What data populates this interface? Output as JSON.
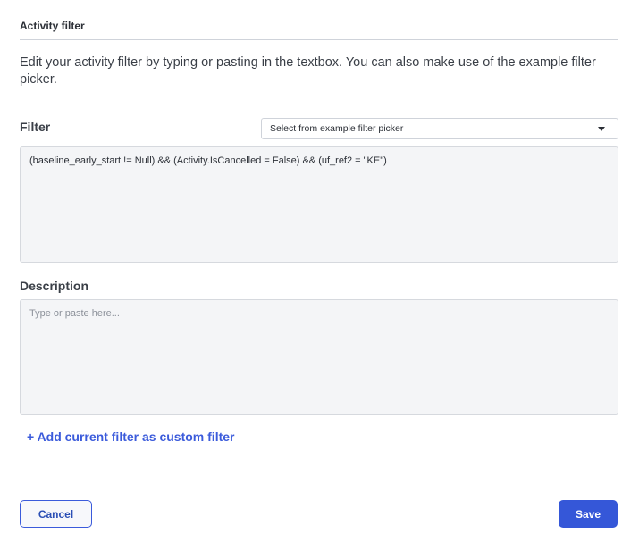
{
  "dialog": {
    "title": "Activity filter",
    "intro": "Edit your activity filter by typing or pasting in the textbox. You can also make use of the example filter picker."
  },
  "filter": {
    "label": "Filter",
    "picker_selected": "Select from example filter picker",
    "value": "(baseline_early_start != Null) && (Activity.IsCancelled = False) && (uf_ref2 = \"KE\")"
  },
  "description": {
    "label": "Description",
    "placeholder": "Type or paste here..."
  },
  "actions": {
    "add_custom_filter": "+ Add current filter as custom filter",
    "cancel": "Cancel",
    "save": "Save"
  },
  "colors": {
    "accent": "#3557d8",
    "link": "#3b5bdb",
    "field_background": "#f4f5f7"
  }
}
